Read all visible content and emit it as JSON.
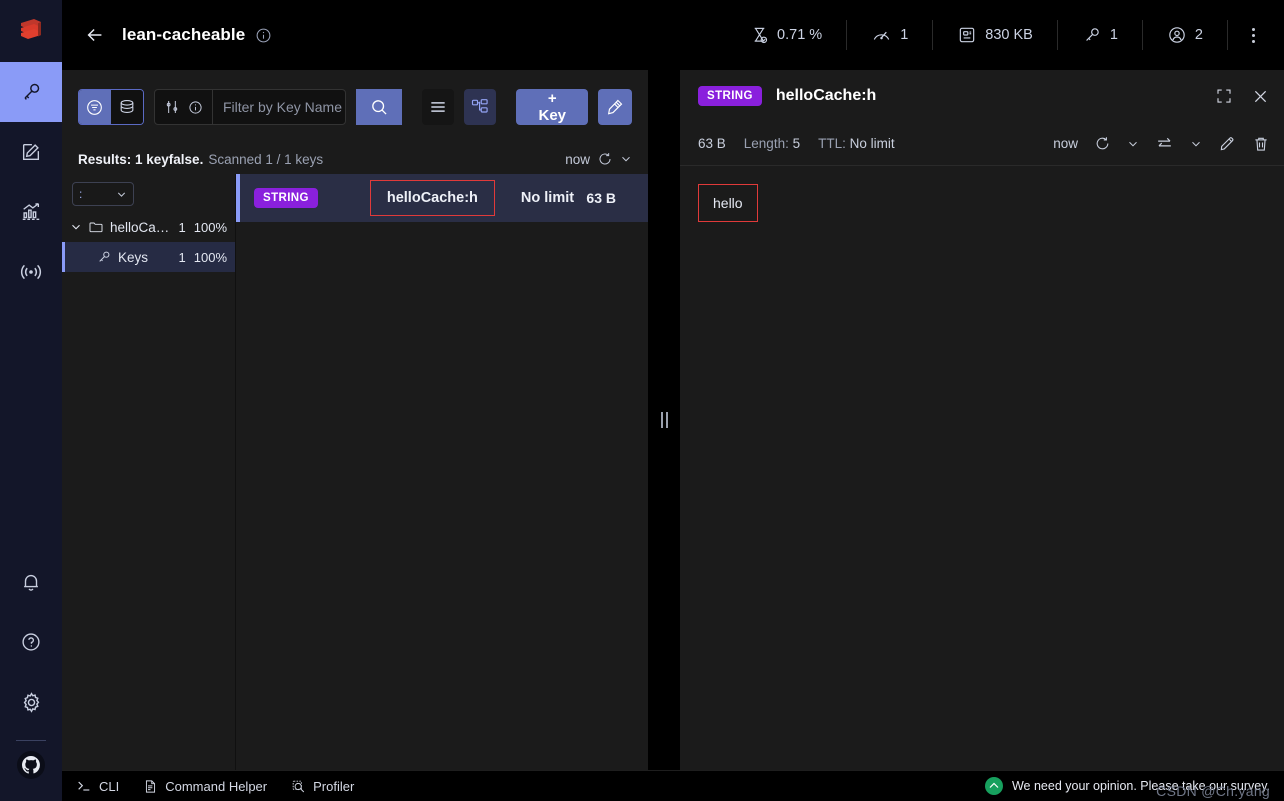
{
  "app": {
    "logo_icon": "redis-logo-icon"
  },
  "sidebar": {
    "items": [
      {
        "icon": "key-icon",
        "name": "browser",
        "active": true
      },
      {
        "icon": "workbench-edit-icon",
        "name": "workbench",
        "active": false
      },
      {
        "icon": "analytics-chart-icon",
        "name": "analysis-tools",
        "active": false
      },
      {
        "icon": "pubsub-broadcast-icon",
        "name": "pub-sub",
        "active": false
      }
    ],
    "bottom_items": [
      {
        "icon": "bell-icon",
        "name": "notifications"
      },
      {
        "icon": "question-circle-icon",
        "name": "help"
      },
      {
        "icon": "gear-icon",
        "name": "settings"
      },
      {
        "icon": "github-icon",
        "name": "github"
      }
    ]
  },
  "header": {
    "back_icon": "arrow-left-icon",
    "database_name": "lean-cacheable",
    "info_icon": "info-circle-icon",
    "stats": [
      {
        "icon": "hourglass-icon",
        "name": "cpu-usage",
        "value": "0.71 %"
      },
      {
        "icon": "gauge-icon",
        "name": "commands-per-sec",
        "value": "1"
      },
      {
        "icon": "memory-chip-icon",
        "name": "memory-used",
        "value": "830 KB"
      },
      {
        "icon": "key-icon",
        "name": "total-keys",
        "value": "1"
      },
      {
        "icon": "user-circle-icon",
        "name": "connected-clients",
        "value": "2"
      }
    ],
    "kebab_icon": "more-vertical-icon"
  },
  "keys_panel": {
    "toolbar": {
      "filter_toggle_icon": "filter-circle-icon",
      "database_toggle_icon": "database-stack-icon",
      "options_icon": "sliders-icon",
      "info_icon": "info-circle-icon",
      "search_placeholder": "Filter by Key Name or Pattern",
      "search_value": "",
      "search_icon": "search-icon",
      "list_view_icon": "list-view-icon",
      "tree_view_icon": "tree-view-icon",
      "add_key_label": "+ Key",
      "bulk_actions_icon": "bulk-actions-icon"
    },
    "results": {
      "strong": "Results: 1 keyfalse.",
      "rest": "Scanned 1 / 1 keys",
      "last_refresh": "now",
      "refresh_icon": "refresh-icon",
      "chevron_icon": "chevron-down-icon"
    },
    "tree": {
      "delimiter_value": ":",
      "delimiter_chevron_icon": "chevron-down-icon",
      "nodes": [
        {
          "expand_icon": "chevron-down-icon",
          "icon": "folder-icon",
          "label": "helloCac...",
          "count": "1",
          "percent": "100%",
          "selected": false
        },
        {
          "icon": "key-icon",
          "label": "Keys",
          "count": "1",
          "percent": "100%",
          "selected": true
        }
      ]
    },
    "key_list": {
      "rows": [
        {
          "type": "STRING",
          "name": "helloCache:h",
          "ttl": "No limit",
          "size": "63 B",
          "selected": true,
          "highlighted": true
        }
      ]
    }
  },
  "details_panel": {
    "type_badge": "STRING",
    "key_name": "helloCache:h",
    "fullscreen_icon": "fullscreen-icon",
    "close_icon": "close-icon",
    "size": "63 B",
    "length_label": "Length:",
    "length_value": "5",
    "ttl_label": "TTL:",
    "ttl_value": "No limit",
    "last_refresh": "now",
    "refresh_icon": "refresh-icon",
    "refresh_chevron_icon": "chevron-down-icon",
    "format_icon": "format-swap-icon",
    "format_chevron_icon": "chevron-down-icon",
    "edit_icon": "pencil-icon",
    "delete_icon": "trash-icon",
    "value": "hello",
    "value_highlighted": true
  },
  "bottom_bar": {
    "items": [
      {
        "icon": "terminal-icon",
        "label": "CLI"
      },
      {
        "icon": "document-icon",
        "label": "Command Helper"
      },
      {
        "icon": "profiler-icon",
        "label": "Profiler"
      }
    ],
    "survey": {
      "icon": "survey-icon",
      "text": "We need your opinion. Please take our survey."
    },
    "watermark": "CSDN @Ch.yang"
  },
  "colors": {
    "accent_blue": "#8a9bf7",
    "button_blue": "#5f6fb8",
    "string_badge": "#8a20dd",
    "highlight_red": "#e03a3a",
    "rail_bg": "#131629",
    "panel_bg": "#1b1b1b",
    "selected_row": "#2a2e45",
    "survey_green": "#17a05e"
  }
}
